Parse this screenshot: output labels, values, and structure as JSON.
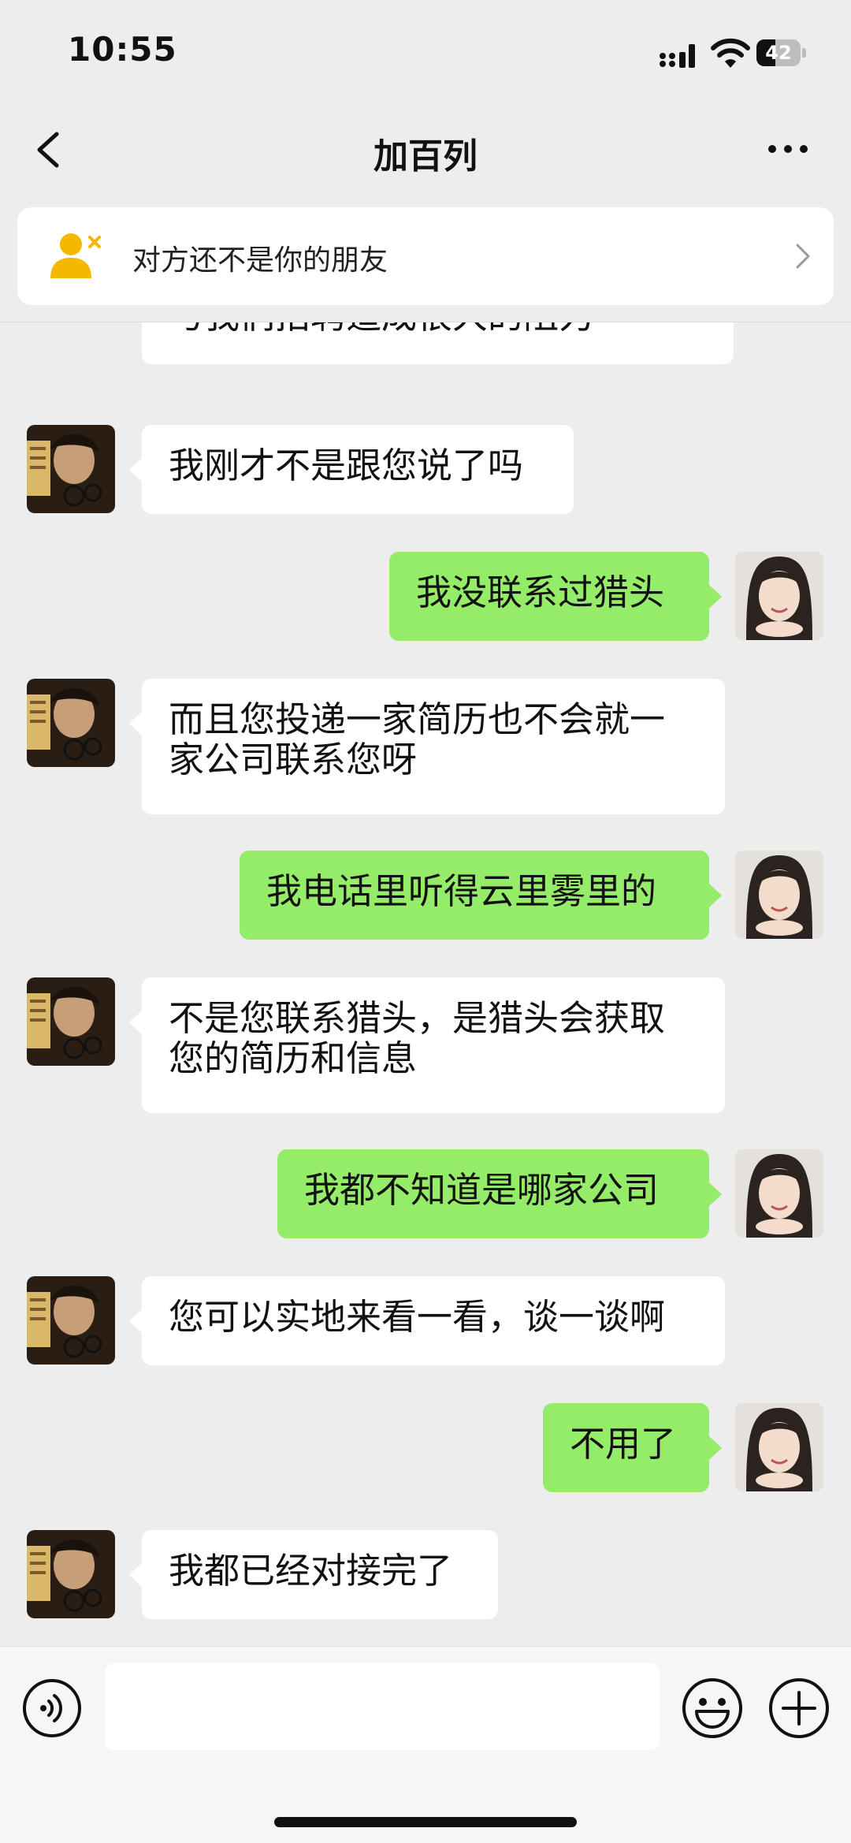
{
  "status_bar": {
    "time": "10:55",
    "battery_percent": 42,
    "battery_label": "42"
  },
  "nav": {
    "title": "加百列",
    "back_icon": "chevron-left-icon",
    "more_icon": "more-dots-icon"
  },
  "notice": {
    "text": "对方还不是你的朋友",
    "icon": "add-user-icon"
  },
  "messages": [
    {
      "side": "in",
      "text": "与我们招聘造成很大的阻力",
      "partial": true
    },
    {
      "side": "in",
      "text": "我刚才不是跟您说了吗"
    },
    {
      "side": "out",
      "text": "我没联系过猎头"
    },
    {
      "side": "in",
      "text": "而且您投递一家简历也不会就一家公司联系您呀"
    },
    {
      "side": "out",
      "text": "我电话里听得云里雾里的"
    },
    {
      "side": "in",
      "text": "不是您联系猎头，是猎头会获取您的简历和信息"
    },
    {
      "side": "out",
      "text": "我都不知道是哪家公司"
    },
    {
      "side": "in",
      "text": "您可以实地来看一看，谈一谈啊"
    },
    {
      "side": "out",
      "text": "不用了"
    },
    {
      "side": "in",
      "text": "我都已经对接完了"
    }
  ],
  "input": {
    "value": "",
    "placeholder": ""
  },
  "input_icons": [
    "voice-icon",
    "emoji-icon",
    "plus-icon"
  ],
  "colors": {
    "outgoing_bubble": "#95ec69",
    "incoming_bubble": "#ffffff",
    "background": "#ededed"
  }
}
